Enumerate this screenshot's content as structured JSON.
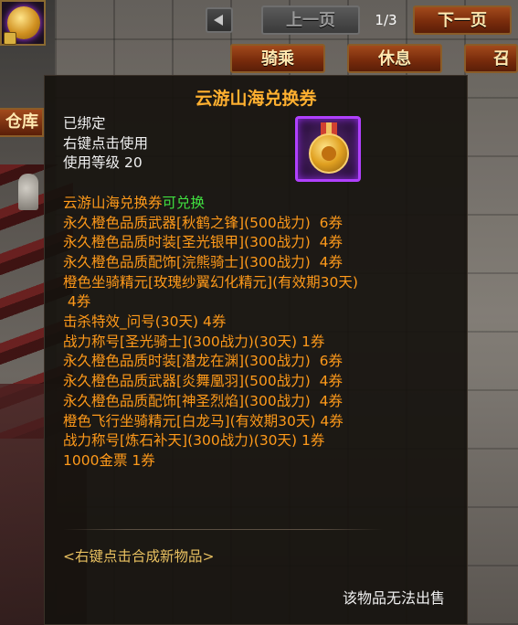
{
  "toolbar": {
    "prev_page": "上一页",
    "page_indicator": "1/3",
    "next_page": "下一页",
    "tabs": [
      "骑乘",
      "休息",
      "召唤"
    ],
    "left_tab": "仓库"
  },
  "tooltip": {
    "title": "云游山海兑换券",
    "bind_status": "已绑定",
    "usage": "右键点击使用",
    "level_label": "使用等级",
    "level_value": "20",
    "exchange_name": "云游山海兑换券",
    "exchange_tag": "可兑换",
    "rewards": [
      "永久橙色品质武器[秋鹤之锋](500战力)  6券",
      "永久橙色品质时装[圣光银甲](300战力)  4券",
      "永久橙色品质配饰[浣熊骑士](300战力)  4券",
      "橙色坐骑精元[玫瑰纱翼幻化精元](有效期30天)",
      " 4券",
      "击杀特效_问号(30天) 4券",
      "战力称号[圣光骑士](300战力)(30天) 1券",
      "永久橙色品质时装[潜龙在渊](300战力)  6券",
      "永久橙色品质武器[炎舞凰羽](500战力)  4券",
      "永久橙色品质配饰[神圣烈焰](300战力)  4券",
      "橙色飞行坐骑精元[白龙马](有效期30天) 4券",
      "战力称号[炼石补天](300战力)(30天) 1券",
      "1000金票 1券"
    ],
    "hint": "<右键点击合成新物品>",
    "footer": "该物品无法出售"
  },
  "colors": {
    "title": "#ffb030",
    "reward": "#ff9a1a",
    "available": "#40e040",
    "icon_border": "#b040ff"
  },
  "icons": [
    "medal-icon",
    "lock-icon",
    "left-arrow-icon"
  ]
}
